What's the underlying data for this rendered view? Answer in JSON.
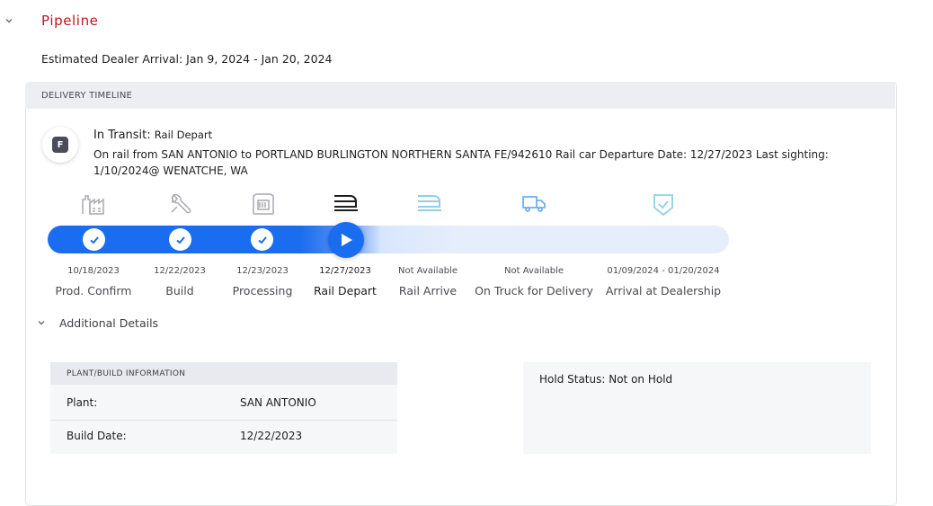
{
  "section": {
    "title": "Pipeline",
    "arrival_label": "Estimated Dealer Arrival: Jan 9, 2024 - Jan 20, 2024"
  },
  "timeline": {
    "header": "DELIVERY TIMELINE",
    "badge_letter": "F",
    "status_prefix": "In Transit:",
    "status_value": "Rail Depart",
    "description": "On rail from SAN ANTONIO to PORTLAND BURLINGTON NORTHERN SANTA FE/942610 Rail car Departure Date: 12/27/2023 Last sighting: 1/10/2024@ WENATCHE, WA",
    "stages": [
      {
        "date": "10/18/2023",
        "name": "Prod. Confirm",
        "icon": "factory-icon",
        "state": "complete"
      },
      {
        "date": "12/22/2023",
        "name": "Build",
        "icon": "wrench-icon",
        "state": "complete"
      },
      {
        "date": "12/23/2023",
        "name": "Processing",
        "icon": "processing-icon",
        "state": "complete"
      },
      {
        "date": "12/27/2023",
        "name": "Rail Depart",
        "icon": "train-icon",
        "state": "current"
      },
      {
        "date": "Not Available",
        "name": "Rail Arrive",
        "icon": "train-arrive-icon",
        "state": "pending"
      },
      {
        "date": "Not Available",
        "name": "On Truck for Delivery",
        "icon": "truck-icon",
        "state": "pending"
      },
      {
        "date": "01/09/2024 - 01/20/2024",
        "name": "Arrival at Dealership",
        "icon": "shield-check-icon",
        "state": "pending"
      }
    ]
  },
  "details": {
    "toggle_label": "Additional Details",
    "plant_header": "PLANT/BUILD INFORMATION",
    "rows": [
      {
        "label": "Plant:",
        "value": "SAN ANTONIO"
      },
      {
        "label": "Build Date:",
        "value": "12/22/2023"
      }
    ],
    "hold_status": "Hold Status: Not on Hold"
  },
  "colors": {
    "accent": "#1a6cf0",
    "title_red": "#c2161a",
    "pending_icon": "#8fd0e6"
  }
}
